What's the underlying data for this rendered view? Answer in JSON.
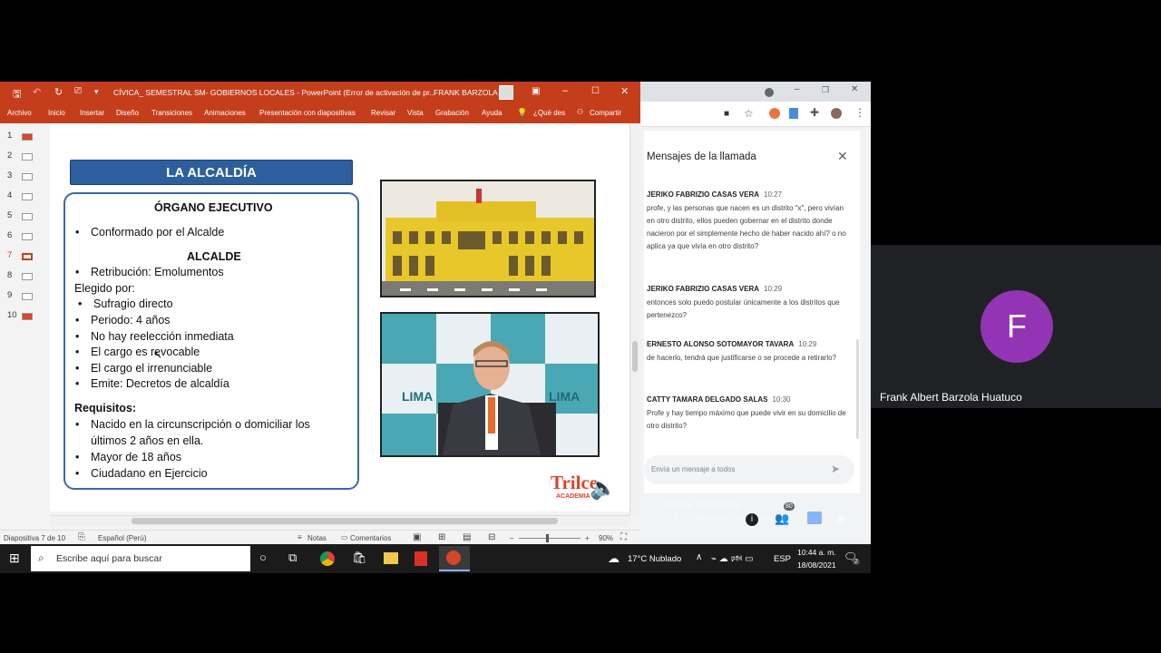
{
  "powerpoint": {
    "title": "CÍVICA_ SEMESTRAL SM- GOBIERNOS LOCALES  -  PowerPoint (Error de activación de pr...",
    "user": "FRANK BARZOLA",
    "menu": [
      "Archivo",
      "Inicio",
      "Insertar",
      "Diseño",
      "Transiciones",
      "Animaciones",
      "Presentación con diapositivas",
      "Revisar",
      "Vista",
      "Grabación",
      "Ayuda",
      "¿Qué des",
      "Compartir"
    ],
    "thumbs": [
      "1",
      "2",
      "3",
      "4",
      "5",
      "6",
      "7",
      "8",
      "9",
      "10"
    ],
    "status": {
      "slide": "Diapositiva 7 de 10",
      "language": "Español (Perú)",
      "notes": "Notas",
      "comments": "Comentarios",
      "zoom": "90%"
    }
  },
  "slide": {
    "banner": "LA ALCALDÍA",
    "heading1": "ÓRGANO EJECUTIVO",
    "item1": "Conformado por el Alcalde",
    "heading2": "ALCALDE",
    "item2": "Retribución: Emolumentos",
    "elected": "Elegido por:",
    "items3": [
      "Sufragio directo",
      "Periodo: 4 años",
      "No hay reelección inmediata",
      "El cargo es revocable",
      "El cargo el irrenunciable",
      "Emite: Decretos de alcaldía"
    ],
    "req": "Requisitos",
    "reqs": [
      "Nacido en la circunscripción o domiciliar los",
      "últimos 2 años en ella.",
      "Mayor de 18 años",
      "Ciudadano en Ejercicio"
    ],
    "logo": "Trilce",
    "logo_sub": "ACADEMIA",
    "lima": "LIMA"
  },
  "chat": {
    "title": "Mensajes de la llamada",
    "messages": [
      {
        "name": "JERIKO FABRIZIO CASAS VERA",
        "time": "10:27",
        "text": "profe, y las personas que nacen es un distrito \"x\", pero vivían en otro distrito, ellos pueden gobernar en el distrito donde nacieron por el simplemente hecho de haber nacido ahí? o no aplica ya que vivía en otro distrito?"
      },
      {
        "name": "JERIKO FABRIZIO CASAS VERA",
        "time": "10:29",
        "text": "entonces solo  puedo postular únicamente a los distritos que pertenezco?"
      },
      {
        "name": "ERNESTO ALONSO SOTOMAYOR TAVARA",
        "time": "10:29",
        "text": "de hacerlo, tendrá que justificarse o se procede a retirarlo?"
      },
      {
        "name": "CATTY TAMARA DELGADO SALAS",
        "time": "10:30",
        "text": "Profe y hay tiempo máximo que puede vivir en su domicilio de otro distrito?"
      }
    ],
    "input_placeholder": "Envía un mensaje a todos",
    "activate1": "Activar Windows",
    "activate2": "Ve a Configuración para activar Windows.",
    "badge": "80"
  },
  "participant": {
    "initial": "F",
    "name": "Frank Albert Barzola Huatuco",
    "color": "#9334b5"
  },
  "taskbar": {
    "search": "Escribe aquí para buscar",
    "weather": "17°C  Nublado",
    "lang": "ESP",
    "time": "10:44 a. m.",
    "date": "18/08/2021",
    "notif": "2"
  }
}
